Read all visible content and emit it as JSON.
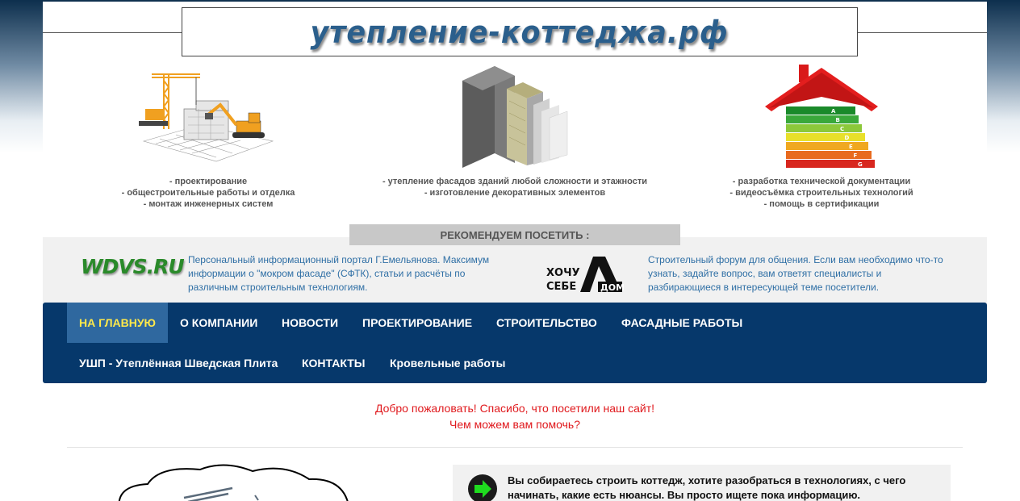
{
  "header": {
    "logo_text": "утепление-коттеджа.рф"
  },
  "services": [
    {
      "lines": [
        "- проектирование",
        "- общестроительные работы и отделка",
        "- монтаж инженерных систем"
      ]
    },
    {
      "lines": [
        "- утепление фасадов зданий любой сложности и этажности",
        "- изготовление декоративных элементов"
      ]
    },
    {
      "lines": [
        "- разработка технической документации",
        "- видеосъёмка строительных технологий",
        "- помощь в сертификации"
      ]
    }
  ],
  "energy_labels": [
    "A",
    "B",
    "C",
    "D",
    "E",
    "F",
    "G"
  ],
  "recommend": {
    "title": "РЕКОМЕНДУЕМ ПОСЕТИТЬ :",
    "site1": {
      "logo": "WDVS.RU",
      "description": "Персональный информационный портал Г.Емельянова. Максимум информации о \"мокром фасаде\" (СФТК), статьи и расчёты по различным строительным технологиям."
    },
    "site2": {
      "logo_lines": [
        "ХОЧУ",
        "СЕБЕ",
        "ДОМ"
      ],
      "description": "Строительный форум для общения. Если вам необходимо что-то узнать, задайте вопрос, вам ответят специалисты и разбирающиеся в интересующей теме посетители."
    }
  },
  "nav": {
    "row1": [
      "НА ГЛАВНУЮ",
      "О КОМПАНИИ",
      "НОВОСТИ",
      "ПРОЕКТИРОВАНИЕ",
      "СТРОИТЕЛЬСТВО",
      "ФАСАДНЫЕ РАБОТЫ"
    ],
    "row2": [
      "УШП - Утеплённая Шведская Плита",
      "КОНТАКТЫ",
      "Кровельные работы"
    ],
    "active_index": 0
  },
  "welcome": {
    "line1": "Добро пожаловать! Спасибо, что посетили наш сайт!",
    "line2": "Чем можем вам помочь?"
  },
  "info": {
    "icon": "arrow-right-icon",
    "text": "Вы собираетесь строить коттедж, хотите разобраться в технологиях, с чего начинать, какие есть нюансы. Вы просто ищете пока информацию."
  },
  "colors": {
    "nav_bg": "#06386b",
    "nav_active_bg": "#2f689f",
    "nav_active_text": "#ffe94a",
    "link_blue": "#2f6fa5",
    "welcome_red": "#e0191d",
    "arrow_green": "#1fdc1f"
  }
}
